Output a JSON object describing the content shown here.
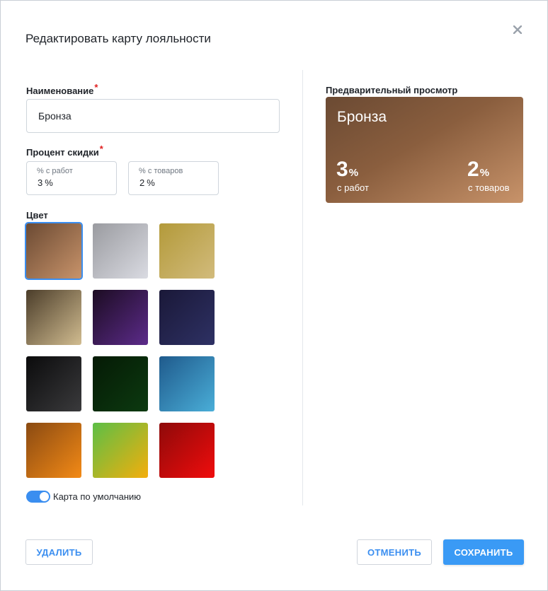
{
  "dialog": {
    "title": "Редактировать карту лояльности"
  },
  "form": {
    "name_label": "Наименование",
    "name_value": "Бронза",
    "discount_label": "Процент скидки",
    "works_label": "% с работ",
    "works_value": "3",
    "goods_label": "% с товаров",
    "goods_value": "2",
    "percent_unit": "%",
    "color_label": "Цвет",
    "required_mark": "*",
    "default_toggle_label": "Карта по умолчанию",
    "default_toggle_on": true
  },
  "colors": [
    {
      "name": "bronze",
      "from": "#6b4a33",
      "to": "#c8936a",
      "selected": true
    },
    {
      "name": "silver",
      "from": "#9a9ba0",
      "to": "#dadbe2",
      "selected": false
    },
    {
      "name": "gold",
      "from": "#b39a3a",
      "to": "#d2bb7c",
      "selected": false
    },
    {
      "name": "sand",
      "from": "#4b3d2a",
      "to": "#d1bc90",
      "selected": false
    },
    {
      "name": "purple",
      "from": "#1c0c22",
      "to": "#5c2b8a",
      "selected": false
    },
    {
      "name": "navy",
      "from": "#1a1838",
      "to": "#2e3164",
      "selected": false
    },
    {
      "name": "black",
      "from": "#0b0b0c",
      "to": "#3a3a3c",
      "selected": false
    },
    {
      "name": "dark-green",
      "from": "#051a05",
      "to": "#0c3a10",
      "selected": false
    },
    {
      "name": "ocean",
      "from": "#1f5a8c",
      "to": "#4aaed8",
      "selected": false
    },
    {
      "name": "orange",
      "from": "#8a4a12",
      "to": "#f38a16",
      "selected": false
    },
    {
      "name": "lime",
      "from": "#5cbf46",
      "to": "#f4ae0c",
      "selected": false
    },
    {
      "name": "red",
      "from": "#8e0a0a",
      "to": "#f00c0c",
      "selected": false
    }
  ],
  "preview": {
    "label": "Предварительный просмотр",
    "card_title": "Бронза",
    "works_value": "3",
    "works_caption": "с работ",
    "goods_value": "2",
    "goods_caption": "с товаров",
    "percent_unit": "%"
  },
  "footer": {
    "delete_label": "УДАЛИТЬ",
    "cancel_label": "ОТМЕНИТЬ",
    "save_label": "СОХРАНИТЬ"
  },
  "icons": {
    "close": "close-icon"
  },
  "theme": {
    "accent": "#3a8ef0",
    "required": "#e02020"
  }
}
